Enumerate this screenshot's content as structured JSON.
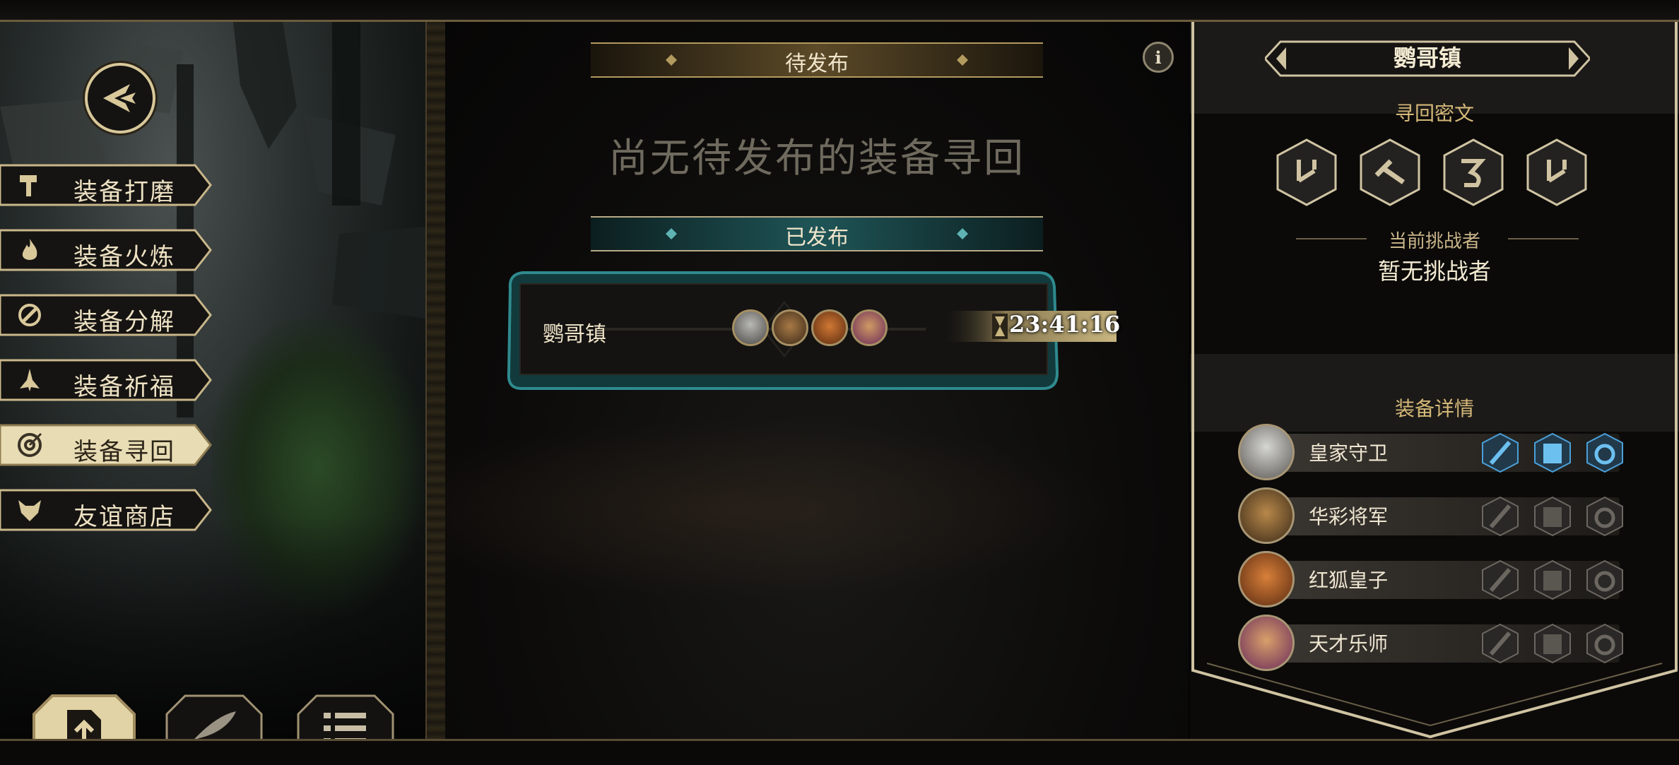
{
  "menu": {
    "items": [
      {
        "label": "装备打磨",
        "icon": "hammer-icon",
        "active": false
      },
      {
        "label": "装备火炼",
        "icon": "flame-icon",
        "active": false
      },
      {
        "label": "装备分解",
        "icon": "disassemble-icon",
        "active": false
      },
      {
        "label": "装备祈福",
        "icon": "pray-hands-icon",
        "active": false
      },
      {
        "label": "装备寻回",
        "icon": "target-icon",
        "active": true
      },
      {
        "label": "友谊商店",
        "icon": "fox-head-icon",
        "active": false
      }
    ]
  },
  "bottom_tabs": [
    {
      "icon": "upload-icon",
      "active": true
    },
    {
      "icon": "quill-icon",
      "active": false
    },
    {
      "icon": "list-icon",
      "active": false
    }
  ],
  "center": {
    "pending_title": "待发布",
    "empty_message": "尚无待发布的装备寻回",
    "published_title": "已发布",
    "quest": {
      "location": "鹦哥镇",
      "timer": "23:41:16",
      "portraits": [
        "knight-portrait",
        "general-portrait",
        "fox-portrait",
        "musician-portrait"
      ]
    }
  },
  "right": {
    "location_title": "鹦哥镇",
    "cipher_title": "寻回密文",
    "cipher_runes": [
      "rune-1-icon",
      "rune-2-icon",
      "rune-3-icon",
      "rune-4-icon"
    ],
    "challenger_label": "当前挑战者",
    "challenger_value": "暂无挑战者",
    "equipment_title": "装备详情",
    "heroes": [
      {
        "name": "皇家守卫",
        "slots_active": true
      },
      {
        "name": "华彩将军",
        "slots_active": false
      },
      {
        "name": "红狐皇子",
        "slots_active": false
      },
      {
        "name": "天才乐师",
        "slots_active": false
      }
    ]
  },
  "colors": {
    "gold": "#d8c89a",
    "teal": "#2f7c80",
    "slot_active": "#4aa0d8",
    "slot_inactive": "#6b6760"
  }
}
